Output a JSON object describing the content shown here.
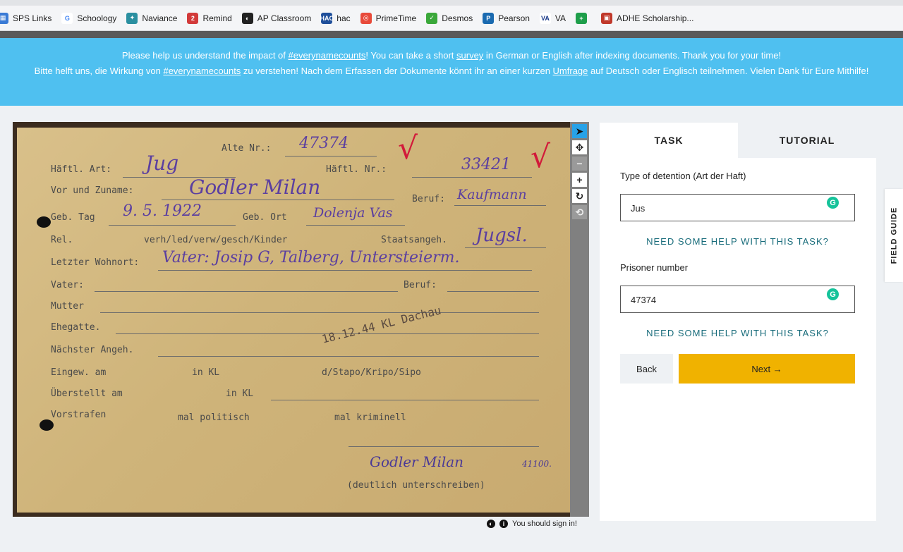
{
  "bookmarks": [
    {
      "label": "SPS Links",
      "icon": "apps-grid-icon",
      "color": "#3a7bd5",
      "glyph": "▦"
    },
    {
      "label": "Schoology",
      "icon": "google-icon",
      "color": "#ffffff",
      "glyph": "G"
    },
    {
      "label": "Naviance",
      "icon": "naviance-icon",
      "color": "#2a8fa0",
      "glyph": "✦"
    },
    {
      "label": "Remind",
      "icon": "remind-icon",
      "color": "#d23a3a",
      "glyph": "2"
    },
    {
      "label": "AP Classroom",
      "icon": "ap-classroom-icon",
      "color": "#222222",
      "glyph": "◐"
    },
    {
      "label": "hac",
      "icon": "hac-icon",
      "color": "#1f4f9a",
      "glyph": "HAC"
    },
    {
      "label": "PrimeTime",
      "icon": "primetime-icon",
      "color": "#e84a3a",
      "glyph": "◎"
    },
    {
      "label": "Desmos",
      "icon": "desmos-icon",
      "color": "#3aa83a",
      "glyph": "✓"
    },
    {
      "label": "Pearson",
      "icon": "pearson-icon",
      "color": "#1a6ab0",
      "glyph": "P"
    },
    {
      "label": "VA",
      "icon": "va-icon",
      "color": "#ffffff",
      "glyph": "VA"
    },
    {
      "label": "",
      "icon": "google-sheets-icon",
      "color": "#1e9e4a",
      "glyph": "+"
    },
    {
      "label": "ADHE Scholarship...",
      "icon": "adhe-icon",
      "color": "#c0392b",
      "glyph": "▣"
    }
  ],
  "banner": {
    "en_1": "Please help us understand the impact of ",
    "en_link1": "#everynamecounts",
    "en_2": "! You can take a short ",
    "en_link2": "survey",
    "en_3": " in German or English after indexing documents. Thank you for your time!",
    "de_1": "Bitte helft uns, die Wirkung von ",
    "de_link1": "#everynamecounts",
    "de_2": " zu verstehen! Nach dem Erfassen der Dokumente könnt ihr an einer kurzen ",
    "de_link2": "Umfrage",
    "de_3": " auf Deutsch oder Englisch teilnehmen. Vielen Dank für Eure Mithilfe!"
  },
  "card": {
    "alte_nr_label": "Alte Nr.:",
    "alte_nr": "47374",
    "haftl_art_label": "Häftl. Art:",
    "haftl_art": "Jug",
    "haftl_nr_label": "Häftl. Nr.:",
    "haftl_nr": "33421",
    "name_label": "Vor und Zuname:",
    "name": "Godler Milan",
    "beruf_label": "Beruf:",
    "beruf": "Kaufmann",
    "geb_label": "Geb. Tag",
    "geb_tag": "9. 5. 1922",
    "geb_ort_label": "Geb. Ort",
    "geb_ort": "Dolenja Vas",
    "rel_label": "Rel.",
    "rel_text": "verh/led/verw/gesch/Kinder",
    "staats_label": "Staatsangeh.",
    "staats": "Jugsl.",
    "wohnort_label": "Letzter Wohnort:",
    "wohnort": "Vater: Josip G, Talberg, Untersteierm.",
    "vater_label": "Vater:",
    "beruf2_label": "Beruf:",
    "mutter_label": "Mutter",
    "ehegatte_label": "Ehegatte.",
    "nachster_label": "Nächster Angeh.",
    "eingew_label": "Eingew. am",
    "eingew_mid": "in KL",
    "eingew_end": "d/Stapo/Kripo/Sipo",
    "uberstellt_label": "Überstellt am",
    "uberstellt_mid": "in KL",
    "vorstrafen_label": "Vorstrafen",
    "vorstrafen_mid": "mal politisch",
    "vorstrafen_end": "mal kriminell",
    "stamp": "18.12.44  KL Dachau",
    "signature": "Godler Milan",
    "signature_num": "41100.",
    "sign_caption": "(deutlich unterschreiben)"
  },
  "viewer_tools": [
    {
      "name": "select-pointer-tool",
      "glyph": "➤",
      "state": "sel"
    },
    {
      "name": "move-tool",
      "glyph": "✥",
      "state": "normal"
    },
    {
      "name": "zoom-out-tool",
      "glyph": "−",
      "state": "dim"
    },
    {
      "name": "zoom-in-tool",
      "glyph": "+",
      "state": "normal"
    },
    {
      "name": "rotate-tool",
      "glyph": "↻",
      "state": "normal"
    },
    {
      "name": "reset-tool",
      "glyph": "⟲",
      "state": "dim"
    }
  ],
  "signin_text": "You should sign in!",
  "panel": {
    "tab_task": "TASK",
    "tab_tutorial": "TUTORIAL",
    "field1_label": "Type of detention (Art der Haft)",
    "field1_value": "Jus",
    "help_text": "NEED SOME HELP WITH THIS TASK?",
    "field2_label": "Prisoner number",
    "field2_value": "47374",
    "back_label": "Back",
    "next_label": "Next →",
    "grammarly_glyph": "G"
  },
  "field_guide": "FIELD GUIDE",
  "colors": {
    "banner": "#4fc0f0",
    "next_button": "#f0b200",
    "help_link": "#176b7a",
    "selected_tool": "#27a2e8"
  }
}
